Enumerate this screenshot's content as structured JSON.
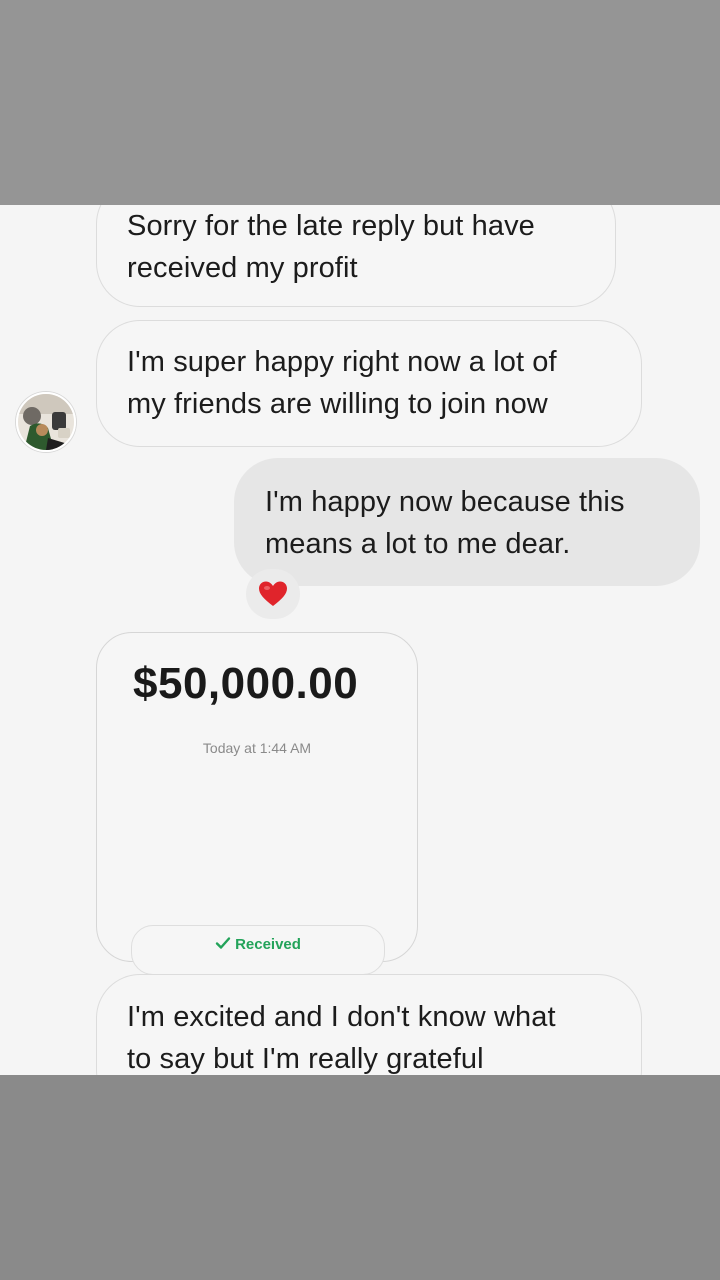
{
  "messages": [
    {
      "text": "Sorry for the late reply but have\nreceived my profit"
    },
    {
      "text": "I'm super happy right now a lot of\nmy friends are willing to join now"
    },
    {
      "text": "I'm happy now because this\nmeans a lot to me dear."
    },
    {
      "text": "I'm excited and I don't know what\nto say but I'm really grateful"
    }
  ],
  "reaction": {
    "icon": "heart-icon",
    "color": "#e0242b"
  },
  "payment": {
    "amount": "$50,000.00",
    "timestamp": "Today at 1:44 AM",
    "status": "Received",
    "status_icon": "check-icon",
    "status_color": "#23a35a"
  },
  "avatar": {
    "icon": "profile-photo"
  }
}
